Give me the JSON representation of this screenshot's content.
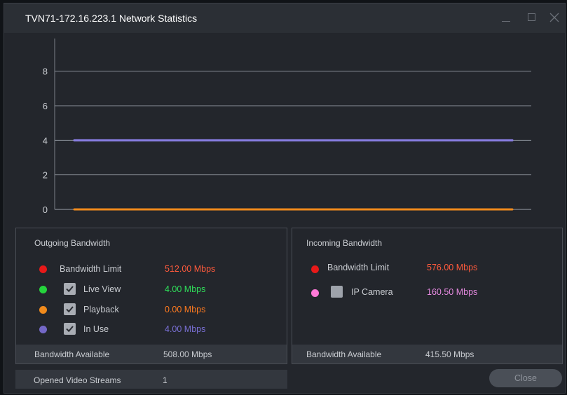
{
  "window": {
    "title": "TVN71-172.16.223.1 Network Statistics"
  },
  "chart_data": {
    "type": "line",
    "title": "",
    "xlabel": "",
    "ylabel": "",
    "ylim": [
      0,
      9
    ],
    "yticks": [
      0,
      2,
      4,
      6,
      8
    ],
    "grid": true,
    "series": [
      {
        "color": "#8a7fe6",
        "values": [
          4,
          4
        ]
      },
      {
        "color": "#f08a1c",
        "values": [
          0,
          0
        ]
      }
    ]
  },
  "outgoing": {
    "title": "Outgoing Bandwidth",
    "rows": [
      {
        "label": "Bandwidth Limit",
        "value": "512.00 Mbps",
        "dot_color": "#e81919",
        "value_color": "#ff5a3c",
        "checkbox": false
      },
      {
        "label": "Live View",
        "value": "4.00 Mbps",
        "dot_color": "#25d43c",
        "value_color": "#2fe05a",
        "checkbox": true
      },
      {
        "label": "Playback",
        "value": "0.00 Mbps",
        "dot_color": "#f08a1c",
        "value_color": "#ff7a1f",
        "checkbox": true
      },
      {
        "label": "In Use",
        "value": "4.00 Mbps",
        "dot_color": "#7468c7",
        "value_color": "#7a70d6",
        "checkbox": true
      }
    ],
    "available_label": "Bandwidth Available",
    "available_value": "508.00 Mbps"
  },
  "incoming": {
    "title": "Incoming Bandwidth",
    "rows": [
      {
        "label": "Bandwidth Limit",
        "value": "576.00 Mbps",
        "dot_color": "#e81919",
        "value_color": "#ff5a3c",
        "checkbox": false
      },
      {
        "label": "IP Camera",
        "value": "160.50 Mbps",
        "dot_color": "#ff7ad8",
        "value_color": "#e58ae0",
        "checkbox": true,
        "checked": false
      }
    ],
    "available_label": "Bandwidth Available",
    "available_value": "415.50 Mbps"
  },
  "streams": {
    "label": "Opened Video Streams",
    "value": "1"
  },
  "close_label": "Close"
}
